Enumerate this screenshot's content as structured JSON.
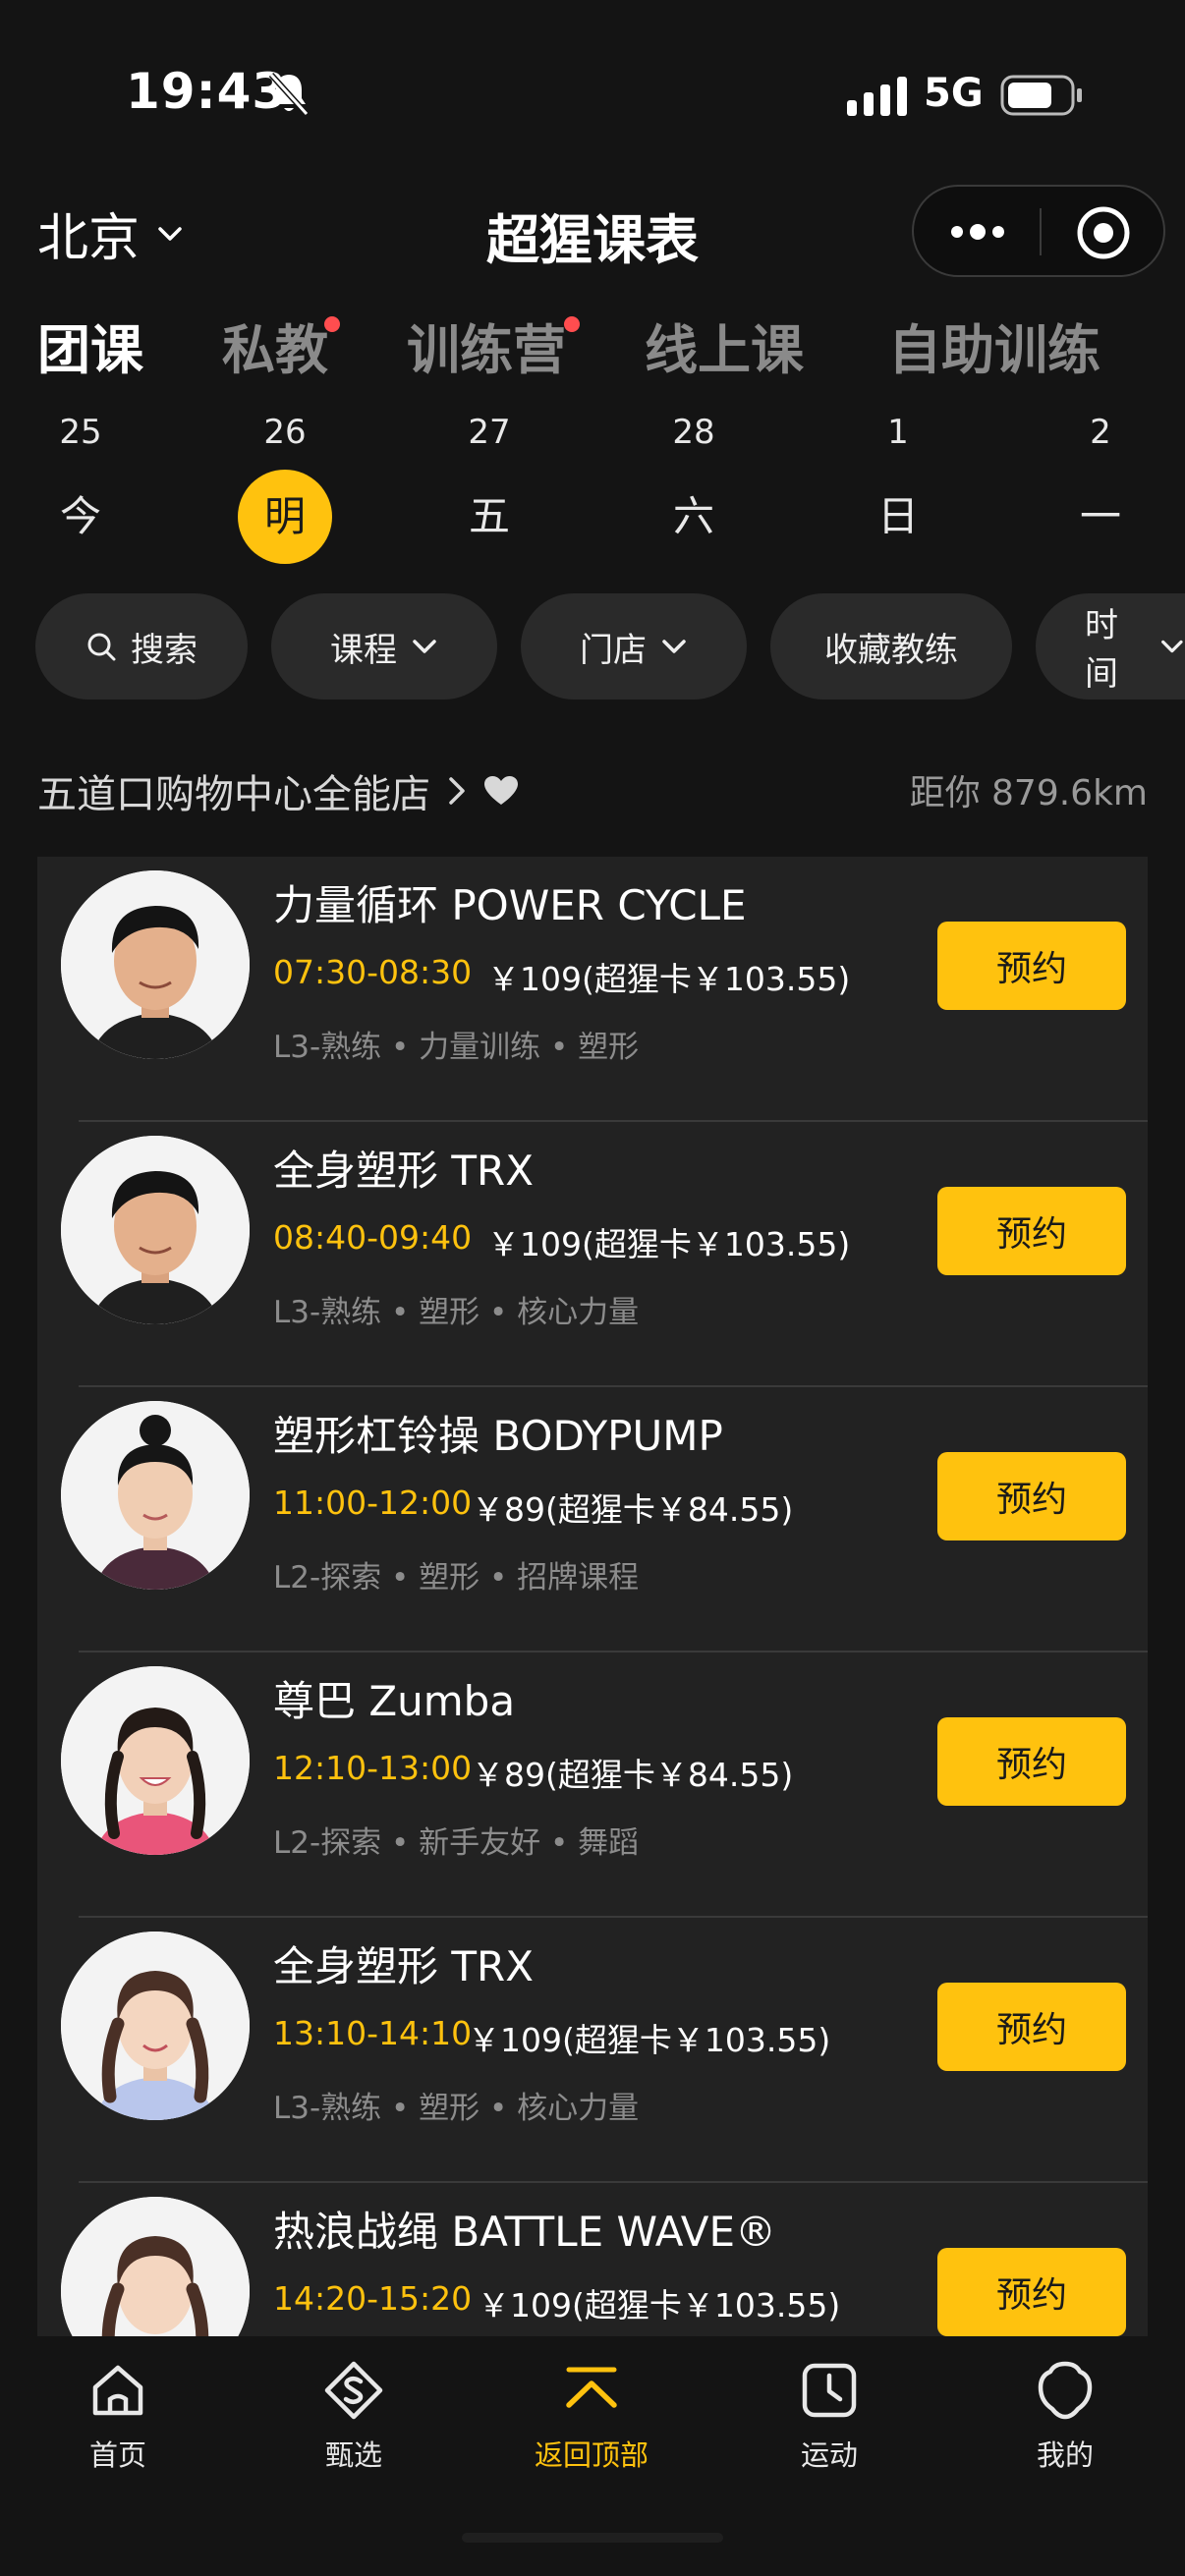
{
  "status_bar": {
    "time": "19:43",
    "network": "5G"
  },
  "nav": {
    "city": "北京",
    "title": "超猩课表"
  },
  "category_tabs": [
    {
      "label": "团课",
      "active": true,
      "badge": false
    },
    {
      "label": "私教",
      "active": false,
      "badge": true
    },
    {
      "label": "训练营",
      "active": false,
      "badge": true
    },
    {
      "label": "线上课",
      "active": false,
      "badge": false
    },
    {
      "label": "自助训练",
      "active": false,
      "badge": false
    }
  ],
  "days": [
    {
      "num": "25",
      "week": "今",
      "selected": false
    },
    {
      "num": "26",
      "week": "明",
      "selected": true
    },
    {
      "num": "27",
      "week": "五",
      "selected": false
    },
    {
      "num": "28",
      "week": "六",
      "selected": false
    },
    {
      "num": "1",
      "week": "日",
      "selected": false
    },
    {
      "num": "2",
      "week": "一",
      "selected": false
    }
  ],
  "filters": {
    "search": "搜索",
    "course": "课程",
    "store": "门店",
    "fav_coach": "收藏教练",
    "time": "时间"
  },
  "store": {
    "name": "五道口购物中心全能店",
    "distance": "距你 879.6km"
  },
  "book_label": "预约",
  "classes": [
    {
      "name": "力量循环 POWER CYCLE",
      "time": "07:30-08:30",
      "price": "￥109(超猩卡￥103.55)",
      "tags": "L3-熟练 • 力量训练 • 塑形"
    },
    {
      "name": "全身塑形 TRX",
      "time": "08:40-09:40",
      "price": "￥109(超猩卡￥103.55)",
      "tags": "L3-熟练 • 塑形 • 核心力量"
    },
    {
      "name": "塑形杠铃操 BODYPUMP",
      "time": "11:00-12:00",
      "price": "￥89(超猩卡￥84.55)",
      "tags": "L2-探索 • 塑形 • 招牌课程"
    },
    {
      "name": "尊巴 Zumba",
      "time": "12:10-13:00",
      "price": "￥89(超猩卡￥84.55)",
      "tags": "L2-探索 • 新手友好 • 舞蹈"
    },
    {
      "name": "全身塑形 TRX",
      "time": "13:10-14:10",
      "price": "￥109(超猩卡￥103.55)",
      "tags": "L3-熟练 • 塑形 • 核心力量"
    },
    {
      "name": "热浪战绳 BATTLE WAVE®",
      "time": "14:20-15:20",
      "price": "￥109(超猩卡￥103.55)",
      "tags": ""
    }
  ],
  "tabbar": [
    {
      "label": "首页",
      "icon": "home-icon",
      "active": false
    },
    {
      "label": "甄选",
      "icon": "select-icon",
      "active": false
    },
    {
      "label": "返回顶部",
      "icon": "back-to-top-icon",
      "active": true
    },
    {
      "label": "运动",
      "icon": "sport-icon",
      "active": false
    },
    {
      "label": "我的",
      "icon": "profile-icon",
      "active": false
    }
  ],
  "colors": {
    "accent": "#ffc20e",
    "background": "#141414",
    "card": "#222222",
    "badge": "#ff4d4f"
  }
}
